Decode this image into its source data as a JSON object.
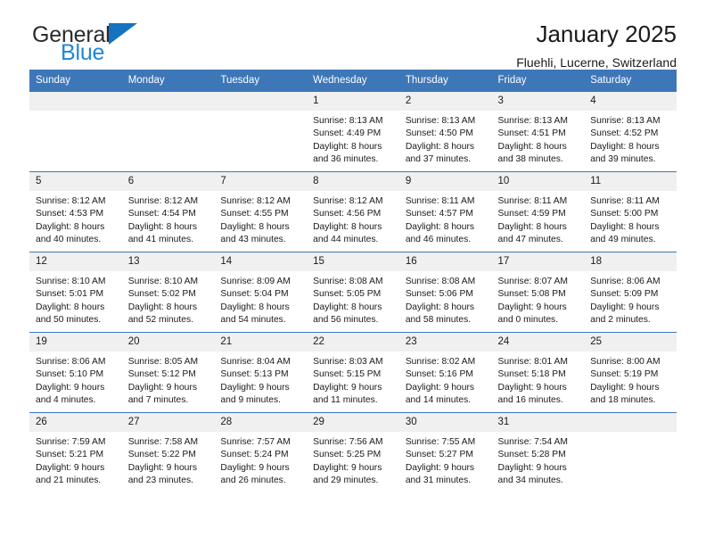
{
  "brand": {
    "name_part1": "General",
    "name_part2": "Blue",
    "flag_icon": "triangle-flag-icon",
    "accent_color": "#1573c0",
    "secondary_color": "#1f86d8"
  },
  "header": {
    "title": "January 2025",
    "location": "Fluehli, Lucerne, Switzerland"
  },
  "calendar": {
    "header_bg": "#3d77b8",
    "daynum_bg": "#f0f0f0",
    "weekdays": [
      "Sunday",
      "Monday",
      "Tuesday",
      "Wednesday",
      "Thursday",
      "Friday",
      "Saturday"
    ],
    "weeks": [
      [
        {
          "day": "",
          "lines": []
        },
        {
          "day": "",
          "lines": []
        },
        {
          "day": "",
          "lines": []
        },
        {
          "day": "1",
          "lines": [
            "Sunrise: 8:13 AM",
            "Sunset: 4:49 PM",
            "Daylight: 8 hours",
            "and 36 minutes."
          ]
        },
        {
          "day": "2",
          "lines": [
            "Sunrise: 8:13 AM",
            "Sunset: 4:50 PM",
            "Daylight: 8 hours",
            "and 37 minutes."
          ]
        },
        {
          "day": "3",
          "lines": [
            "Sunrise: 8:13 AM",
            "Sunset: 4:51 PM",
            "Daylight: 8 hours",
            "and 38 minutes."
          ]
        },
        {
          "day": "4",
          "lines": [
            "Sunrise: 8:13 AM",
            "Sunset: 4:52 PM",
            "Daylight: 8 hours",
            "and 39 minutes."
          ]
        }
      ],
      [
        {
          "day": "5",
          "lines": [
            "Sunrise: 8:12 AM",
            "Sunset: 4:53 PM",
            "Daylight: 8 hours",
            "and 40 minutes."
          ]
        },
        {
          "day": "6",
          "lines": [
            "Sunrise: 8:12 AM",
            "Sunset: 4:54 PM",
            "Daylight: 8 hours",
            "and 41 minutes."
          ]
        },
        {
          "day": "7",
          "lines": [
            "Sunrise: 8:12 AM",
            "Sunset: 4:55 PM",
            "Daylight: 8 hours",
            "and 43 minutes."
          ]
        },
        {
          "day": "8",
          "lines": [
            "Sunrise: 8:12 AM",
            "Sunset: 4:56 PM",
            "Daylight: 8 hours",
            "and 44 minutes."
          ]
        },
        {
          "day": "9",
          "lines": [
            "Sunrise: 8:11 AM",
            "Sunset: 4:57 PM",
            "Daylight: 8 hours",
            "and 46 minutes."
          ]
        },
        {
          "day": "10",
          "lines": [
            "Sunrise: 8:11 AM",
            "Sunset: 4:59 PM",
            "Daylight: 8 hours",
            "and 47 minutes."
          ]
        },
        {
          "day": "11",
          "lines": [
            "Sunrise: 8:11 AM",
            "Sunset: 5:00 PM",
            "Daylight: 8 hours",
            "and 49 minutes."
          ]
        }
      ],
      [
        {
          "day": "12",
          "lines": [
            "Sunrise: 8:10 AM",
            "Sunset: 5:01 PM",
            "Daylight: 8 hours",
            "and 50 minutes."
          ]
        },
        {
          "day": "13",
          "lines": [
            "Sunrise: 8:10 AM",
            "Sunset: 5:02 PM",
            "Daylight: 8 hours",
            "and 52 minutes."
          ]
        },
        {
          "day": "14",
          "lines": [
            "Sunrise: 8:09 AM",
            "Sunset: 5:04 PM",
            "Daylight: 8 hours",
            "and 54 minutes."
          ]
        },
        {
          "day": "15",
          "lines": [
            "Sunrise: 8:08 AM",
            "Sunset: 5:05 PM",
            "Daylight: 8 hours",
            "and 56 minutes."
          ]
        },
        {
          "day": "16",
          "lines": [
            "Sunrise: 8:08 AM",
            "Sunset: 5:06 PM",
            "Daylight: 8 hours",
            "and 58 minutes."
          ]
        },
        {
          "day": "17",
          "lines": [
            "Sunrise: 8:07 AM",
            "Sunset: 5:08 PM",
            "Daylight: 9 hours",
            "and 0 minutes."
          ]
        },
        {
          "day": "18",
          "lines": [
            "Sunrise: 8:06 AM",
            "Sunset: 5:09 PM",
            "Daylight: 9 hours",
            "and 2 minutes."
          ]
        }
      ],
      [
        {
          "day": "19",
          "lines": [
            "Sunrise: 8:06 AM",
            "Sunset: 5:10 PM",
            "Daylight: 9 hours",
            "and 4 minutes."
          ]
        },
        {
          "day": "20",
          "lines": [
            "Sunrise: 8:05 AM",
            "Sunset: 5:12 PM",
            "Daylight: 9 hours",
            "and 7 minutes."
          ]
        },
        {
          "day": "21",
          "lines": [
            "Sunrise: 8:04 AM",
            "Sunset: 5:13 PM",
            "Daylight: 9 hours",
            "and 9 minutes."
          ]
        },
        {
          "day": "22",
          "lines": [
            "Sunrise: 8:03 AM",
            "Sunset: 5:15 PM",
            "Daylight: 9 hours",
            "and 11 minutes."
          ]
        },
        {
          "day": "23",
          "lines": [
            "Sunrise: 8:02 AM",
            "Sunset: 5:16 PM",
            "Daylight: 9 hours",
            "and 14 minutes."
          ]
        },
        {
          "day": "24",
          "lines": [
            "Sunrise: 8:01 AM",
            "Sunset: 5:18 PM",
            "Daylight: 9 hours",
            "and 16 minutes."
          ]
        },
        {
          "day": "25",
          "lines": [
            "Sunrise: 8:00 AM",
            "Sunset: 5:19 PM",
            "Daylight: 9 hours",
            "and 18 minutes."
          ]
        }
      ],
      [
        {
          "day": "26",
          "lines": [
            "Sunrise: 7:59 AM",
            "Sunset: 5:21 PM",
            "Daylight: 9 hours",
            "and 21 minutes."
          ]
        },
        {
          "day": "27",
          "lines": [
            "Sunrise: 7:58 AM",
            "Sunset: 5:22 PM",
            "Daylight: 9 hours",
            "and 23 minutes."
          ]
        },
        {
          "day": "28",
          "lines": [
            "Sunrise: 7:57 AM",
            "Sunset: 5:24 PM",
            "Daylight: 9 hours",
            "and 26 minutes."
          ]
        },
        {
          "day": "29",
          "lines": [
            "Sunrise: 7:56 AM",
            "Sunset: 5:25 PM",
            "Daylight: 9 hours",
            "and 29 minutes."
          ]
        },
        {
          "day": "30",
          "lines": [
            "Sunrise: 7:55 AM",
            "Sunset: 5:27 PM",
            "Daylight: 9 hours",
            "and 31 minutes."
          ]
        },
        {
          "day": "31",
          "lines": [
            "Sunrise: 7:54 AM",
            "Sunset: 5:28 PM",
            "Daylight: 9 hours",
            "and 34 minutes."
          ]
        },
        {
          "day": "",
          "lines": []
        }
      ]
    ]
  }
}
